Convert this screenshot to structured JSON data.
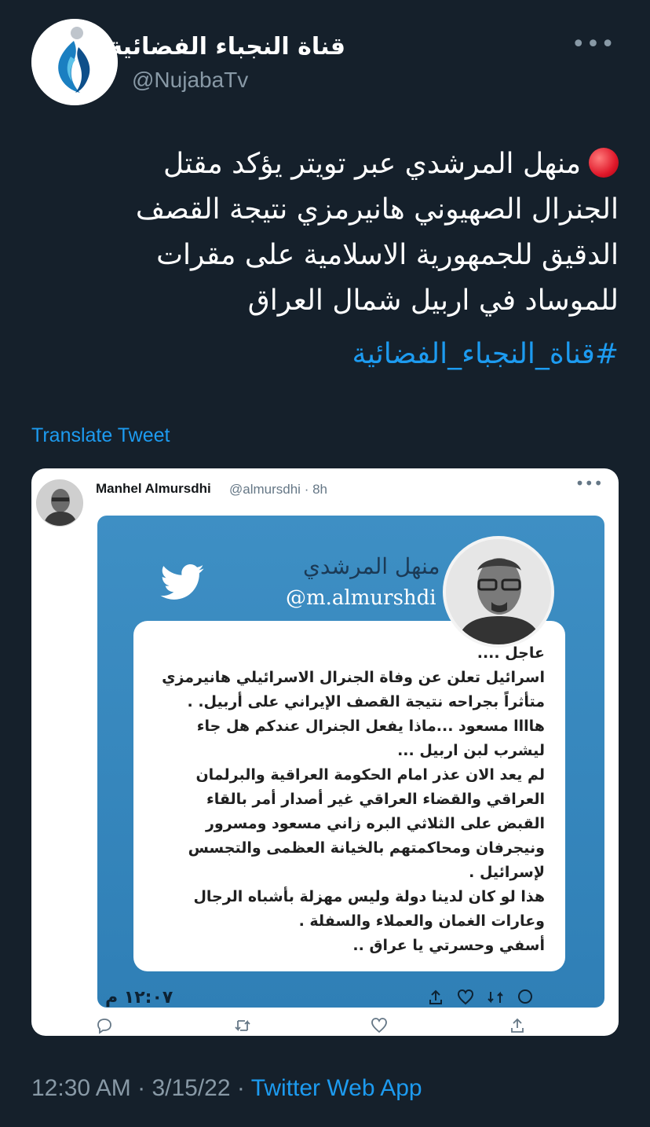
{
  "author": {
    "display_name": "قناة النجباء الفضائية",
    "handle": "@NujabaTv"
  },
  "tweet": {
    "text": "منهل المرشدي عبر تويتر يؤكد مقتل الجنرال الصهيوني هانيرمزي نتيجة القصف الدقيق للجمهورية الاسلامية على مقرات للموساد في اربيل شمال العراق",
    "hashtag": "#قناة_النجباء_الفضائية",
    "translate_label": "Translate Tweet"
  },
  "quoted_tweet": {
    "name": "Manhel Almursdhi",
    "handle": "@almursdhi",
    "time": "8h",
    "image": {
      "name": "منهل المرشدي",
      "handle": "@m.almurshdi",
      "text_lines": [
        "عاجل ....",
        "اسرائيل تعلن عن وفاة الجنرال الاسرائيلي هانيرمزي",
        "متأثراً بجراحه نتيجة القصف الإيراني على أربيل. .",
        "هاااا مسعود ...ماذا يفعل الجنرال عندكم هل جاء",
        "ليشرب لبن اربيل ...",
        "لم يعد الان عذر امام الحكومة العراقية والبرلمان",
        "العراقي والقضاء العراقي غير أصدار أمر بالقاء",
        "القبض على الثلاثي البره زاني مسعود ومسرور",
        "ونيجرفان ومحاكمتهم بالخيانة العظمى والتجسس",
        "لإسرائيل .",
        "هذا لو كان لدينا دولة وليس مهزلة بأشباه الرجال",
        "وعارات الغمان والعملاء والسفلة .",
        "أسفي وحسرتي يا عراق .."
      ],
      "footer_time": "١٢:٠٧ م"
    }
  },
  "meta": {
    "time": "12:30 AM",
    "date": "3/15/22",
    "separator": "·",
    "app": "Twitter Web App"
  },
  "colors": {
    "background": "#15202b",
    "accent": "#1d9bf0",
    "muted": "#8899a6"
  }
}
